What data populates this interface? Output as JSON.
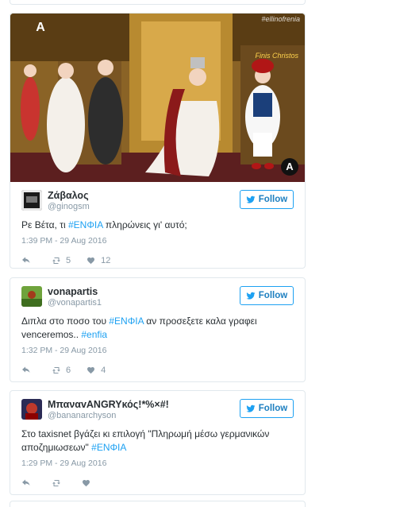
{
  "tweets": [
    {
      "display_name": "Ζάβαλος",
      "handle": "@ginogsm",
      "follow_label": "Follow",
      "text_before": "Ρε Βέτα, τι ",
      "hashtag": "#ΕΝΦΙΑ",
      "text_after": " πληρώνεις γι' αυτό;",
      "time": "1:39 PM - 29 Aug 2016",
      "retweets": "5",
      "likes": "12",
      "media": {
        "channel_logo": "Α",
        "hashtag_overlay": "#ellinofrenia",
        "caption": "Finis Christos"
      }
    },
    {
      "display_name": "vonapartis",
      "handle": "@vonapartis1",
      "follow_label": "Follow",
      "text_line1_before": "Διπλα στο ποσο του ",
      "hashtag": "#ΕΝΦΙΑ",
      "text_line1_after": " αν προσεξετε καλα γραφει",
      "text_line2_before": "venceremos.. ",
      "hashtag2": "#enfia",
      "time": "1:32 PM - 29 Aug 2016",
      "retweets": "6",
      "likes": "4"
    },
    {
      "display_name": "ΜπαναvANGRYκός!*%×#!",
      "handle": "@bananarchyson",
      "follow_label": "Follow",
      "text_line1": "Στο taxisnet βγάζει κι επιλογή \"Πληρωμή μέσω γερμανικών",
      "text_line2_before": "αποζημιωσεων\" ",
      "hashtag": "#ΕΝΦΙΑ",
      "time": "1:29 PM - 29 Aug 2016",
      "retweets": "",
      "likes": ""
    }
  ],
  "colors": {
    "accent": "#1da1f2",
    "text": "#292f33",
    "muted": "#8899a6",
    "border": "#e1e8ed"
  },
  "icons": [
    "reply-icon",
    "retweet-icon",
    "like-icon",
    "twitter-bird-icon"
  ]
}
